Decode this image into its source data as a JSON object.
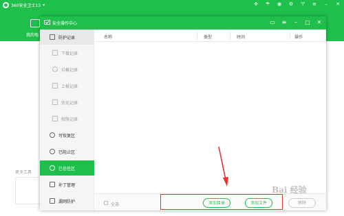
{
  "background_app": {
    "title": "360安全卫士13",
    "tab_label": "我的电",
    "more_tools_label": "更多工具"
  },
  "dialog": {
    "title": "安全操作中心"
  },
  "sidebar": {
    "items": [
      {
        "label": "防护记录",
        "icon": "checklist-icon",
        "type": "top"
      },
      {
        "label": "下载记录",
        "icon": "download-icon",
        "type": "sub"
      },
      {
        "label": "拦截记录",
        "icon": "block-icon",
        "type": "sub"
      },
      {
        "label": "上报记录",
        "icon": "upload-icon",
        "type": "sub"
      },
      {
        "label": "优化记录",
        "icon": "optimize-icon",
        "type": "sub"
      },
      {
        "label": "权限记录",
        "icon": "permission-icon",
        "type": "sub"
      },
      {
        "label": "可恢复区",
        "icon": "restore-icon",
        "type": "main"
      },
      {
        "label": "已阻止区",
        "icon": "shield-icon",
        "type": "main"
      },
      {
        "label": "已信任区",
        "icon": "trust-shield-icon",
        "type": "active"
      },
      {
        "label": "补丁管理",
        "icon": "patch-icon",
        "type": "main"
      },
      {
        "label": "漏网防护",
        "icon": "net-protect-icon",
        "type": "main"
      }
    ]
  },
  "table": {
    "columns": [
      "名称",
      "类型",
      "时间",
      "操作"
    ]
  },
  "footer": {
    "select_all_label": "全选",
    "add_directory_button": "添加目录",
    "add_file_button": "添加文件",
    "remove_button": "移除"
  },
  "watermark": "Bai 经验",
  "colors": {
    "brand_green": "#1fbf4c",
    "highlight_red": "#e53333"
  }
}
